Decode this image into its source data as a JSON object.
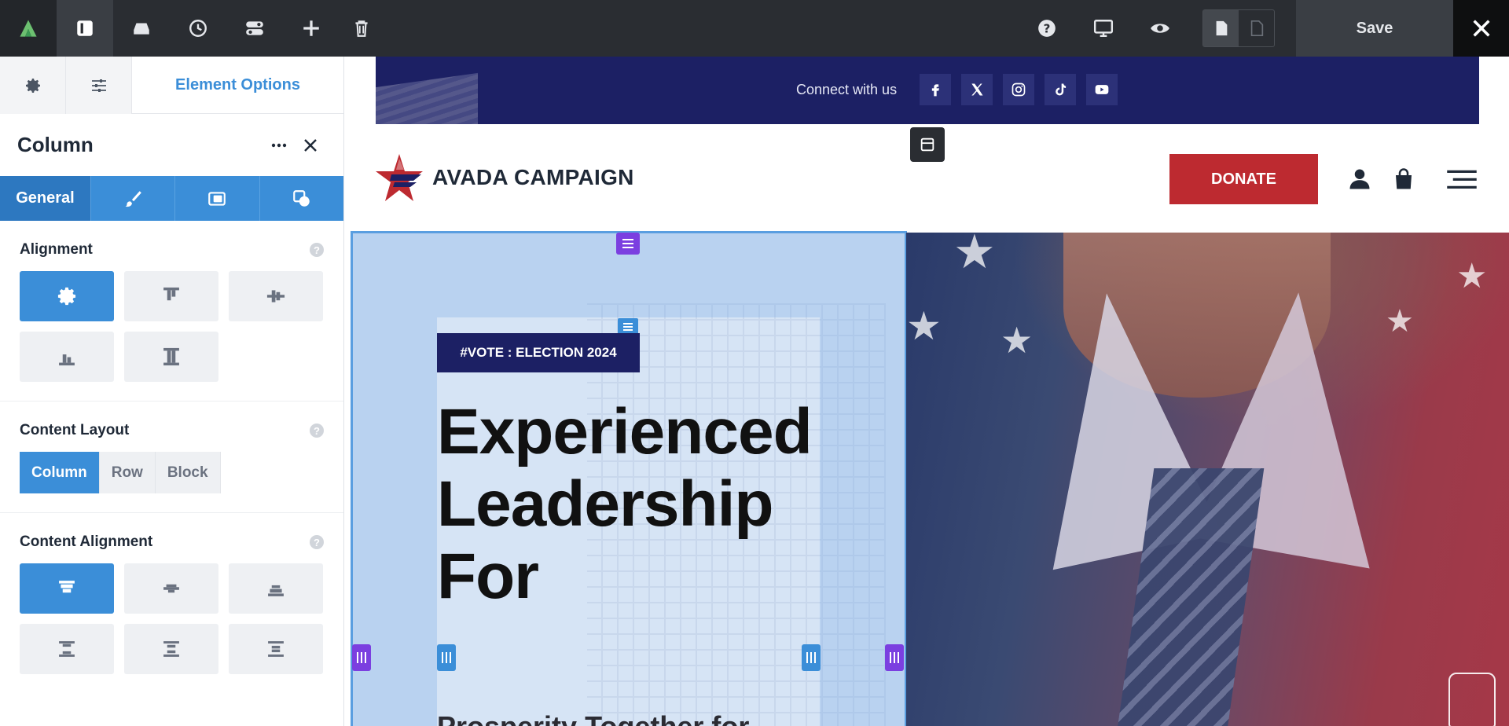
{
  "toolbar": {
    "logo_icon": "avada-logo-icon",
    "tools": [
      "sidebar-icon",
      "library-icon",
      "history-icon",
      "toggles-icon",
      "add-icon",
      "trash-icon"
    ],
    "right_tools": [
      "help-icon",
      "desktop-icon",
      "preview-icon"
    ],
    "save_label": "Save",
    "close_icon": "close-icon"
  },
  "panel": {
    "tabs": {
      "main_label": "Element Options"
    },
    "title": "Column",
    "subtabs": {
      "general_label": "General"
    },
    "alignment": {
      "title": "Alignment",
      "help": "?"
    },
    "content_layout": {
      "title": "Content Layout",
      "help": "?",
      "options": [
        "Column",
        "Row",
        "Block"
      ],
      "selected": "Column"
    },
    "content_alignment": {
      "title": "Content Alignment",
      "help": "?"
    }
  },
  "site": {
    "connect_label": "Connect with us",
    "social": [
      "facebook-icon",
      "x-icon",
      "instagram-icon",
      "tiktok-icon",
      "youtube-icon"
    ],
    "brand": "AVADA CAMPAIGN",
    "donate_label": "DONATE",
    "tag": "#VOTE : ELECTION 2024",
    "headline_1": "Experienced",
    "headline_2": "Leadership",
    "headline_3": "For",
    "headline_partial": "Prosperity Together for"
  },
  "colors": {
    "accent_blue": "#3b8ed8",
    "navy": "#1c2064",
    "donate_red": "#bd2a30",
    "handle_purple": "#7b3fe0",
    "toolbar_dark": "#2a2d32"
  }
}
